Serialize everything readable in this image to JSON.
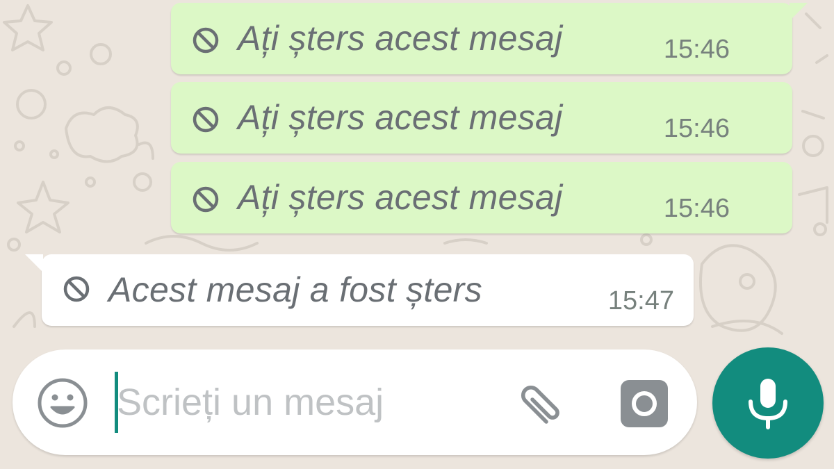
{
  "colors": {
    "outgoing_bubble": "#DCF8C6",
    "incoming_bubble": "#FFFFFF",
    "chat_background": "#ECE5DD",
    "accent": "#128C7E",
    "placeholder": "#BFC2C4"
  },
  "messages": [
    {
      "direction": "outgoing",
      "icon": "deleted-ban-icon",
      "text": "Ați șters acest mesaj",
      "time": "15:46"
    },
    {
      "direction": "outgoing",
      "icon": "deleted-ban-icon",
      "text": "Ați șters acest mesaj",
      "time": "15:46"
    },
    {
      "direction": "outgoing",
      "icon": "deleted-ban-icon",
      "text": "Ați șters acest mesaj",
      "time": "15:46"
    },
    {
      "direction": "incoming",
      "icon": "deleted-ban-icon",
      "text": "Acest mesaj a fost șters",
      "time": "15:47"
    }
  ],
  "composer": {
    "placeholder": "Scrieți un mesaj",
    "value": "",
    "emoji_icon": "emoji-smile-icon",
    "attach_icon": "paperclip-icon",
    "camera_icon": "camera-icon",
    "send_icon": "microphone-icon"
  }
}
